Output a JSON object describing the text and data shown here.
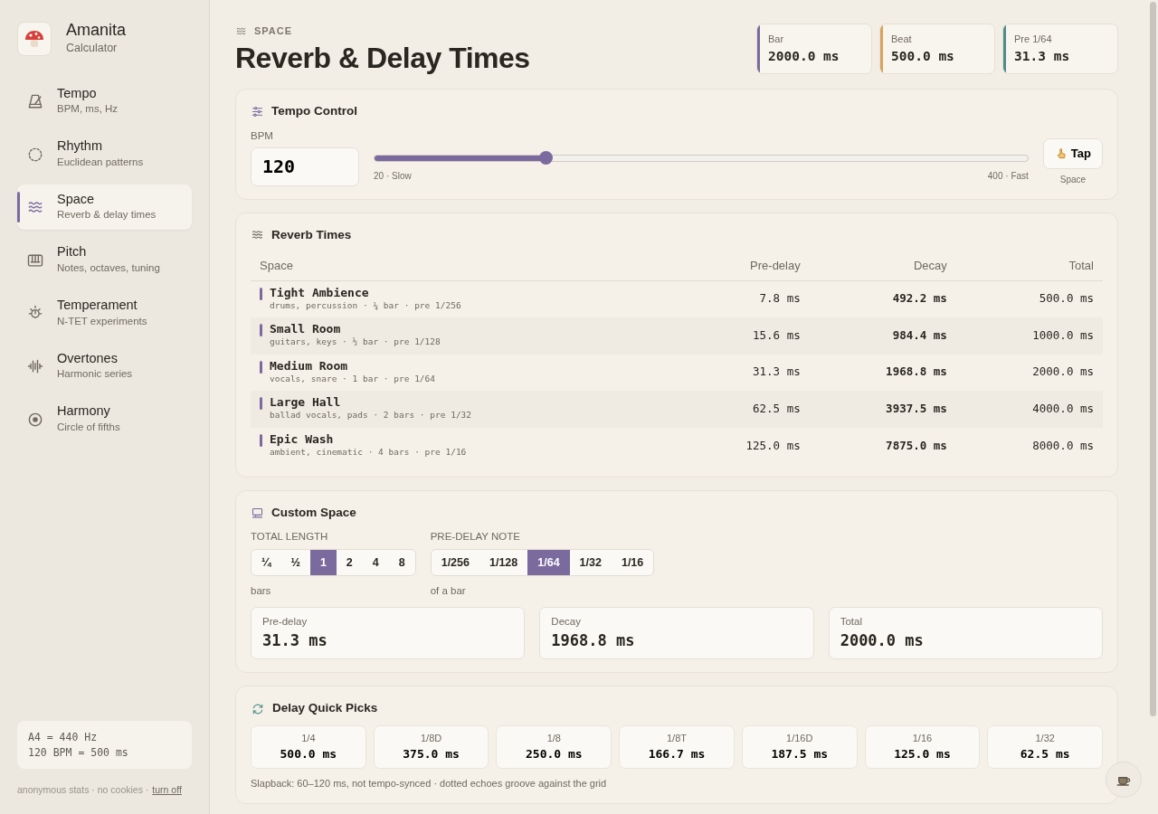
{
  "brand": {
    "name": "Amanita",
    "subtitle": "Calculator"
  },
  "nav": [
    {
      "kind": "metronome",
      "label": "Tempo",
      "sub": "BPM, ms, Hz",
      "selected": false
    },
    {
      "kind": "circle",
      "label": "Rhythm",
      "sub": "Euclidean patterns",
      "selected": false
    },
    {
      "kind": "waves",
      "label": "Space",
      "sub": "Reverb & delay times",
      "selected": true
    },
    {
      "kind": "keys",
      "label": "Pitch",
      "sub": "Notes, octaves, tuning",
      "selected": false
    },
    {
      "kind": "sun",
      "label": "Temperament",
      "sub": "N-TET experiments",
      "selected": false
    },
    {
      "kind": "wave",
      "label": "Overtones",
      "sub": "Harmonic series",
      "selected": false
    },
    {
      "kind": "target",
      "label": "Harmony",
      "sub": "Circle of fifths",
      "selected": false
    }
  ],
  "sidebar_info": [
    "A4 = 440 Hz",
    "120 BPM = 500 ms"
  ],
  "footer": {
    "text": "anonymous stats · no cookies ·",
    "link": "turn off"
  },
  "page": {
    "section": "SPACE",
    "title": "Reverb & Delay Times"
  },
  "stats": [
    {
      "label": "Bar",
      "value": "2000.0 ms",
      "color": "#7b6a9e"
    },
    {
      "label": "Beat",
      "value": "500.0 ms",
      "color": "#d9a35a"
    },
    {
      "label": "Pre 1/64",
      "value": "31.3 ms",
      "color": "#4f8c88"
    }
  ],
  "tempo": {
    "title": "Tempo Control",
    "bpm_label": "BPM",
    "bpm": "120",
    "level": 0.263,
    "min_label": "20 · Slow",
    "max_label": "400 · Fast",
    "tap": "Tap",
    "tap_hint": "Space"
  },
  "reverb": {
    "title": "Reverb Times",
    "columns": [
      "Space",
      "Pre-delay",
      "Decay",
      "Total"
    ],
    "rows": [
      {
        "name": "Tight Ambience",
        "detail": "drums, percussion · ¼ bar · pre 1/256",
        "pre": "7.8 ms",
        "decay": "492.2 ms",
        "total": "500.0 ms"
      },
      {
        "name": "Small Room",
        "detail": "guitars, keys · ½ bar · pre 1/128",
        "pre": "15.6 ms",
        "decay": "984.4 ms",
        "total": "1000.0 ms"
      },
      {
        "name": "Medium Room",
        "detail": "vocals, snare · 1 bar · pre 1/64",
        "pre": "31.3 ms",
        "decay": "1968.8 ms",
        "total": "2000.0 ms"
      },
      {
        "name": "Large Hall",
        "detail": "ballad vocals, pads · 2 bars · pre 1/32",
        "pre": "62.5 ms",
        "decay": "3937.5 ms",
        "total": "4000.0 ms"
      },
      {
        "name": "Epic Wash",
        "detail": "ambient, cinematic · 4 bars · pre 1/16",
        "pre": "125.0 ms",
        "decay": "7875.0 ms",
        "total": "8000.0 ms"
      }
    ]
  },
  "custom": {
    "title": "Custom Space",
    "groups": [
      {
        "label": "TOTAL LENGTH",
        "unit": "bars",
        "options": [
          {
            "label": "¼",
            "selected": false
          },
          {
            "label": "½",
            "selected": false
          },
          {
            "label": "1",
            "selected": true
          },
          {
            "label": "2",
            "selected": false
          },
          {
            "label": "4",
            "selected": false
          },
          {
            "label": "8",
            "selected": false
          }
        ]
      },
      {
        "label": "PRE-DELAY NOTE",
        "unit": "of a bar",
        "options": [
          {
            "label": "1/256",
            "selected": false
          },
          {
            "label": "1/128",
            "selected": false
          },
          {
            "label": "1/64",
            "selected": true
          },
          {
            "label": "1/32",
            "selected": false
          },
          {
            "label": "1/16",
            "selected": false
          }
        ]
      }
    ],
    "results": [
      {
        "label": "Pre-delay",
        "value": "31.3 ms"
      },
      {
        "label": "Decay",
        "value": "1968.8 ms"
      },
      {
        "label": "Total",
        "value": "2000.0 ms"
      }
    ]
  },
  "delay": {
    "title": "Delay Quick Picks",
    "picks": [
      {
        "note": "1/4",
        "value": "500.0 ms"
      },
      {
        "note": "1/8D",
        "value": "375.0 ms"
      },
      {
        "note": "1/8",
        "value": "250.0 ms"
      },
      {
        "note": "1/8T",
        "value": "166.7 ms"
      },
      {
        "note": "1/16D",
        "value": "187.5 ms"
      },
      {
        "note": "1/16",
        "value": "125.0 ms"
      },
      {
        "note": "1/32",
        "value": "62.5 ms"
      }
    ],
    "note": "Slapback: 60–120 ms, not tempo-synced · dotted echoes groove against the grid"
  }
}
